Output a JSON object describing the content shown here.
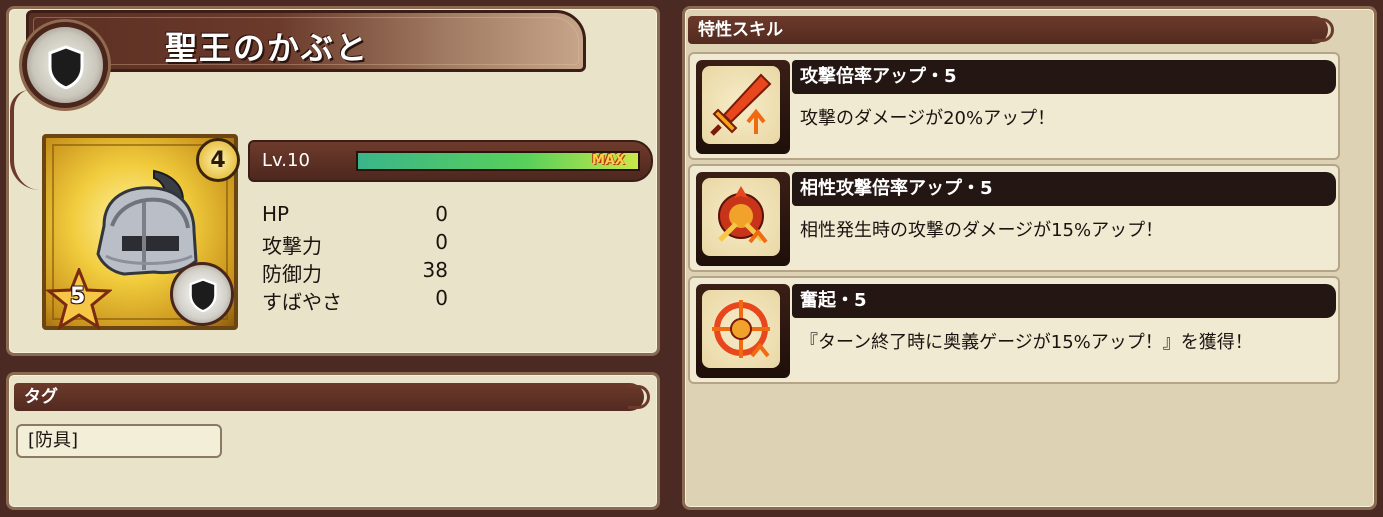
{
  "item": {
    "name": "聖王のかぶと",
    "level_label": "Lv.10",
    "level_max_label": "MAX",
    "level_progress": 1.0,
    "badge_number": "4",
    "rarity_stars": "5"
  },
  "stats": [
    {
      "label": "HP",
      "value": "0"
    },
    {
      "label": "攻撃力",
      "value": "0"
    },
    {
      "label": "防御力",
      "value": "38"
    },
    {
      "label": "すばやさ",
      "value": "0"
    }
  ],
  "tags": {
    "header": "タグ",
    "items": [
      "[防具]"
    ]
  },
  "skills": {
    "header": "特性スキル",
    "items": [
      {
        "name": "攻撃倍率アップ・5",
        "description": "攻撃のダメージが20%アップ！",
        "icon": "sword-up-icon"
      },
      {
        "name": "相性攻撃倍率アップ・5",
        "description": "相性発生時の攻撃のダメージが15%アップ！",
        "icon": "affinity-attack-icon"
      },
      {
        "name": "奮起・5",
        "description": "『ターン終了時に奥義ゲージが15%アップ！』を獲得！",
        "icon": "rally-icon"
      }
    ]
  },
  "colors": {
    "panel_bg": "#e9e3c9",
    "header_brown": "#6b3a2b",
    "gold": "#f1cc3d",
    "bar_green": "#58d05a"
  }
}
